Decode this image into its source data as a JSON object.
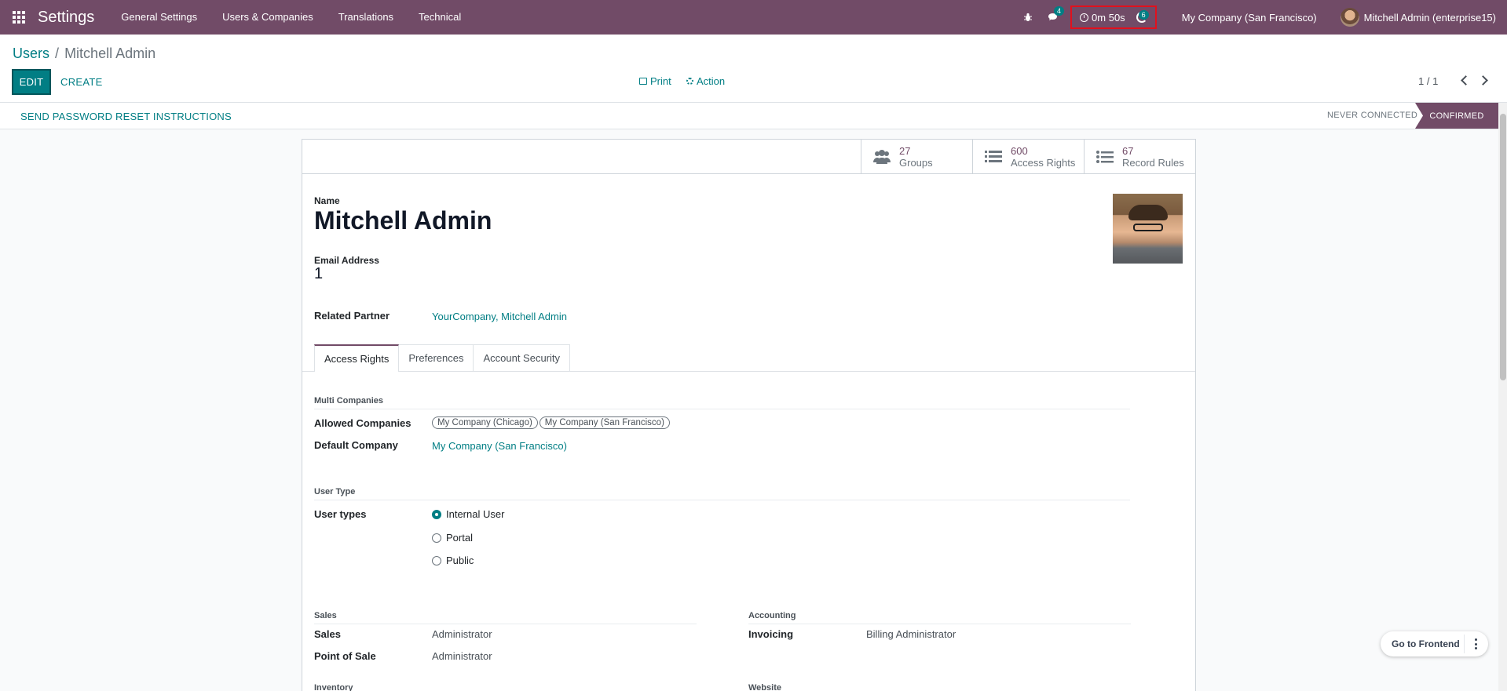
{
  "navbar": {
    "app_name": "Settings",
    "menu": [
      "General Settings",
      "Users & Companies",
      "Translations",
      "Technical"
    ],
    "chat_badge": "4",
    "timer": "0m 50s",
    "activity_badge": "6",
    "company": "My Company (San Francisco)",
    "user": "Mitchell Admin (enterprise15)",
    "color": "#714b67"
  },
  "breadcrumb": {
    "parent": "Users",
    "separator": "/",
    "current": "Mitchell Admin"
  },
  "toolbar": {
    "edit": "EDIT",
    "create": "CREATE",
    "print": "Print",
    "action": "Action",
    "pager": "1 / 1"
  },
  "statusbar": {
    "reset_password": "SEND PASSWORD RESET INSTRUCTIONS",
    "states": [
      "NEVER CONNECTED",
      "CONFIRMED"
    ],
    "active_state": "CONFIRMED"
  },
  "smart_buttons": [
    {
      "value": "27",
      "label": "Groups",
      "icon": "users-icon"
    },
    {
      "value": "600",
      "label": "Access Rights",
      "icon": "list-icon"
    },
    {
      "value": "67",
      "label": "Record Rules",
      "icon": "list-ul-icon"
    }
  ],
  "form": {
    "name_label": "Name",
    "name": "Mitchell Admin",
    "email_label": "Email Address",
    "email": "1",
    "related_partner_label": "Related Partner",
    "related_partner": "YourCompany, Mitchell Admin"
  },
  "tabs": [
    "Access Rights",
    "Preferences",
    "Account Security"
  ],
  "access_rights": {
    "multi_companies_title": "Multi Companies",
    "allowed_companies_label": "Allowed Companies",
    "allowed_companies": [
      "My Company (Chicago)",
      "My Company (San Francisco)"
    ],
    "default_company_label": "Default Company",
    "default_company": "My Company (San Francisco)",
    "user_type_title": "User Type",
    "user_types_label": "User types",
    "user_types": [
      "Internal User",
      "Portal",
      "Public"
    ],
    "selected_user_type": "Internal User",
    "sales_title": "Sales",
    "sales_label": "Sales",
    "sales_value": "Administrator",
    "pos_label": "Point of Sale",
    "pos_value": "Administrator",
    "accounting_title": "Accounting",
    "invoicing_label": "Invoicing",
    "invoicing_value": "Billing Administrator",
    "inventory_title": "Inventory",
    "website_title": "Website"
  },
  "frontend_button": "Go to Frontend"
}
